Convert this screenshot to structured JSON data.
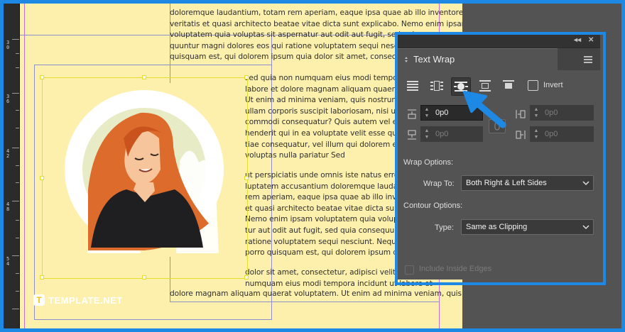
{
  "document": {
    "body_lines_top": [
      "doloremque laudantium, totam rem aperiam, eaque ipsa quae ab illo inventore",
      "veritatis et quasi architecto beatae vitae dicta sunt explicabo. Nemo enim ipsam",
      "voluptatem quia voluptas sit aspernatur aut odit aut fugit, sed quia conse",
      "quuntur magni dolores eos qui ratione voluptatem sequi nesciunt. Neque porro",
      "quisquam est, qui dolorem ipsum quia dolor sit amet, consectetur, adipisci"
    ],
    "body_lines_right_1": [
      "sed quia non numquam eius modi tempora incidunt ut",
      "labore et dolore magnam aliquam quaerat voluptatem.",
      "Ut enim ad minima veniam, quis nostrum exercitationem",
      "ullam corporis suscipit laboriosam, nisi ut aliquid ex ea",
      "commodi consequatur? Quis autem vel eum iure repre",
      "henderit qui in ea voluptate velit esse quam nihil mo",
      "tiae consequatur, vel illum qui dolorem eum fugiat quo",
      "voluptas nulla pariatur Sed"
    ],
    "body_lines_right_2": [
      "ut perspiciatis unde omnis iste natus error sit volup",
      "luptatem accusantium doloremque laudantium, totam",
      "rem aperiam, eaque ipsa quae ab illo inventore verita",
      "et quasi architecto beatae vitae dicta sunt explicabo.",
      "Nemo enim ipsam voluptatem quia voluptas sit aspernatur",
      "tur aut odit aut fugit, sed quia consequuntur magni",
      "ratione voluptatem sequi nesciunt. Neque porro quis",
      "porro quisquam est, qui dolorem ipsum quia dolor"
    ],
    "body_lines_right_3": [
      "dolor sit amet, consectetur, adipisci velit, sed quia non",
      "numquam eius modi tempora incidunt ut labore et"
    ],
    "body_line_bottom": "dolore magnam aliquam quaerat voluptatem. Ut enim ad minima veniam, quis",
    "ruler_numbers": [
      "3\n0",
      "3\n6",
      "4\n2",
      "4\n8",
      "5\n4"
    ],
    "logo_text": "TEMPLATE.NET"
  },
  "panel": {
    "title": "Text Wrap",
    "invert_label": "Invert",
    "offsets": {
      "top": "0p0",
      "bottom": "0p0",
      "left": "0p0",
      "right": "0p0"
    },
    "wrap_options_label": "Wrap Options:",
    "wrap_to_label": "Wrap To:",
    "wrap_to_value": "Both Right & Left Sides",
    "contour_options_label": "Contour Options:",
    "type_label": "Type:",
    "type_value": "Same as Clipping",
    "include_inside_edges_label": "Include Inside Edges",
    "colors": {
      "highlight": "#1e88e5",
      "panel_bg": "#535353"
    }
  }
}
